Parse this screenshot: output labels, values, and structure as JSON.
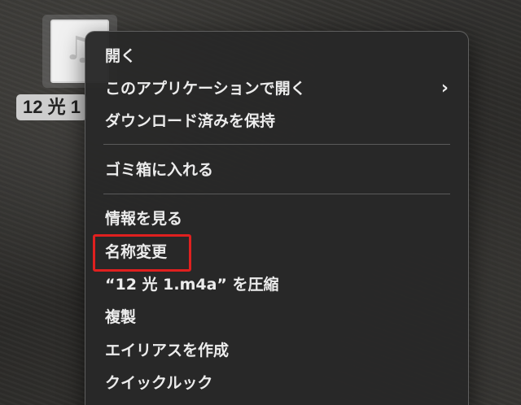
{
  "desktop": {
    "file_label": "12 光 1",
    "file_icon": "music-note-icon"
  },
  "context_menu": {
    "open": "開く",
    "open_with": "このアプリケーションで開く",
    "keep_downloaded": "ダウンロード済みを保持",
    "move_to_trash": "ゴミ箱に入れる",
    "get_info": "情報を見る",
    "rename": "名称変更",
    "compress": "“12 光 1.m4a” を圧縮",
    "duplicate": "複製",
    "make_alias": "エイリアスを作成",
    "quick_look": "クイックルック"
  },
  "annotation": {
    "highlight_color": "#e0201f"
  }
}
